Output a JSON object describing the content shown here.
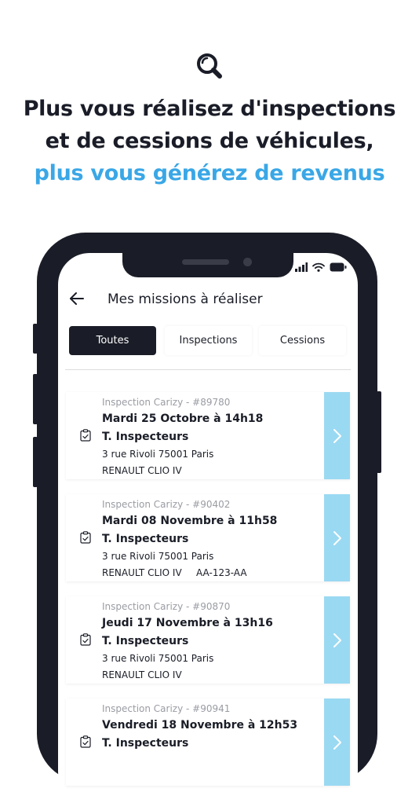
{
  "colors": {
    "dark": "#1a1d27",
    "accent": "#3aa7e6",
    "card_action": "#9ad9f2",
    "muted": "#9a9ca3"
  },
  "hero": {
    "icon": "magnifier-icon",
    "line1": "Plus vous réalisez d'inspections",
    "line2": "et de cessions de véhicules,",
    "line3": "plus vous générez de revenus"
  },
  "status_bar": {
    "icons": [
      "signal-icon",
      "wifi-icon",
      "battery-icon"
    ]
  },
  "screen": {
    "back_icon": "arrow-left-icon",
    "title": "Mes missions à réaliser",
    "tabs": [
      {
        "label": "Toutes",
        "active": true
      },
      {
        "label": "Inspections",
        "active": false
      },
      {
        "label": "Cessions",
        "active": false
      }
    ],
    "missions": [
      {
        "ref": "Inspection Carizy - #89780",
        "date": "Mardi 25 Octobre à 14h18",
        "name": "T. Inspecteurs",
        "address": "3 rue Rivoli 75001 Paris",
        "car": "RENAULT CLIO IV",
        "plate": ""
      },
      {
        "ref": "Inspection Carizy - #90402",
        "date": "Mardi 08 Novembre à 11h58",
        "name": "T. Inspecteurs",
        "address": "3 rue Rivoli 75001 Paris",
        "car": "RENAULT CLIO IV",
        "plate": "AA-123-AA"
      },
      {
        "ref": "Inspection Carizy - #90870",
        "date": "Jeudi 17 Novembre à 13h16",
        "name": "T. Inspecteurs",
        "address": "3 rue Rivoli 75001 Paris",
        "car": "RENAULT CLIO IV",
        "plate": ""
      },
      {
        "ref": "Inspection Carizy - #90941",
        "date": "Vendredi 18 Novembre à 12h53",
        "name": "T. Inspecteurs",
        "address": "",
        "car": "",
        "plate": ""
      }
    ]
  }
}
